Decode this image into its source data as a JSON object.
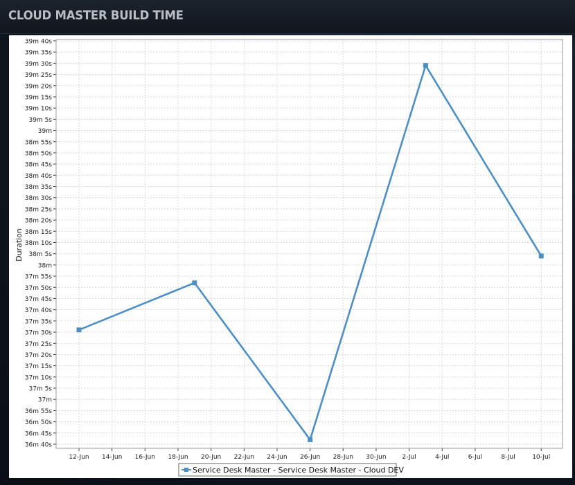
{
  "window": {
    "title": "CLOUD MASTER BUILD TIME"
  },
  "colors": {
    "series": "#4d8fc4",
    "grid": "#d9d9d9",
    "axis": "#333333"
  },
  "chart_data": {
    "type": "line",
    "title": "",
    "xlabel": "",
    "ylabel": "Duration",
    "x_ticks": [
      "12-Jun",
      "14-Jun",
      "16-Jun",
      "18-Jun",
      "20-Jun",
      "22-Jun",
      "24-Jun",
      "26-Jun",
      "28-Jun",
      "30-Jun",
      "2-Jul",
      "4-Jul",
      "6-Jul",
      "8-Jul",
      "10-Jul"
    ],
    "y_ticks": [
      "36m 40s",
      "36m 45s",
      "36m 50s",
      "36m 55s",
      "37m",
      "37m 5s",
      "37m 10s",
      "37m 15s",
      "37m 20s",
      "37m 25s",
      "37m 30s",
      "37m 35s",
      "37m 40s",
      "37m 45s",
      "37m 50s",
      "37m 55s",
      "38m",
      "38m 5s",
      "38m 10s",
      "38m 15s",
      "38m 20s",
      "38m 25s",
      "38m 30s",
      "38m 35s",
      "38m 40s",
      "38m 45s",
      "38m 50s",
      "38m 55s",
      "39m",
      "39m 5s",
      "39m 10s",
      "39m 15s",
      "39m 20s",
      "39m 25s",
      "39m 30s",
      "39m 35s",
      "39m 40s"
    ],
    "ylim_seconds": [
      2200,
      2380
    ],
    "grid": true,
    "legend_position": "bottom-center",
    "series": [
      {
        "name": "Service Desk Master - Service Desk Master  - Cloud DEV",
        "marker": "square",
        "x": [
          "2016-06-12",
          "2016-06-19",
          "2016-06-26",
          "2016-07-03",
          "2016-07-10"
        ],
        "y_seconds": [
          2251,
          2272,
          2202,
          2369,
          2284
        ],
        "y": [
          "37m 31s",
          "37m 52s",
          "36m 42s",
          "39m 29s",
          "38m 4s"
        ]
      }
    ]
  }
}
